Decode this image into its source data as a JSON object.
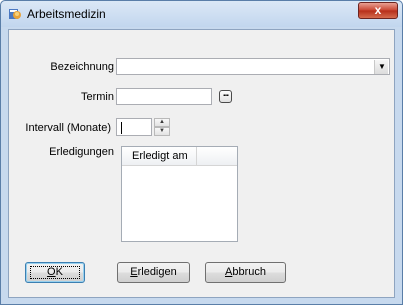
{
  "window": {
    "title": "Arbeitsmedizin",
    "close_symbol": "x",
    "icon": "app-icon"
  },
  "form": {
    "bezeichnung_label": "Bezeichnung",
    "bezeichnung_value": "",
    "termin_label": "Termin",
    "termin_value": "",
    "termin_button": "...",
    "intervall_label": "Intervall (Monate)",
    "intervall_value": "",
    "erledigungen_label": "Erledigungen",
    "list_header": "Erledigt am",
    "list_rows": []
  },
  "buttons": {
    "ok_mnemonic": "O",
    "ok_rest": "K",
    "erledigen_mnemonic": "E",
    "erledigen_rest": "rledigen",
    "abbruch_mnemonic": "A",
    "abbruch_rest": "bbruch"
  }
}
